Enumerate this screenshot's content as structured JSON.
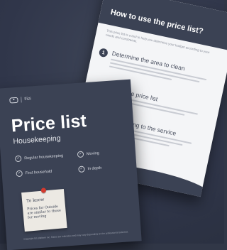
{
  "back_sheet": {
    "title": "How to use the price list?",
    "intro": "This price list is a tool to help you determine your budget according to your needs and constraints.",
    "steps": [
      {
        "number": "1",
        "title": "Determine the area to clean"
      },
      {
        "number": "",
        "title": "in the price list"
      },
      {
        "number": "",
        "title": "according to the service"
      }
    ]
  },
  "front_sheet": {
    "brand": "Fizi",
    "title": "Price list",
    "subtitle": "Housekeeping",
    "services": [
      "Regular housekeeping",
      "Moving",
      "First household",
      "In depth"
    ],
    "note": {
      "title": "To know",
      "text": "Prices for Outside are similar to those for moving"
    },
    "footer": "Copyright fizi platform inc. Rates are indicative and may vary depending on the professional selected."
  }
}
